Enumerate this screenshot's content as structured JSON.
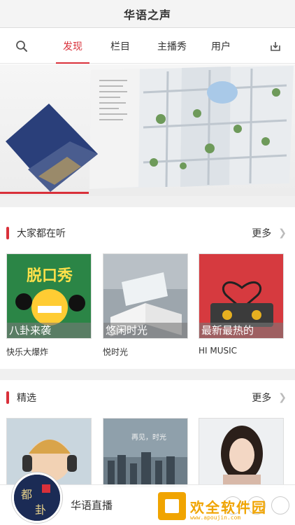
{
  "app": {
    "title": "华语之声"
  },
  "nav": {
    "tabs": [
      {
        "label": "发现"
      },
      {
        "label": "栏目"
      },
      {
        "label": "主播秀"
      },
      {
        "label": "用户"
      }
    ],
    "active_tab": "发现",
    "search_icon": "search-icon",
    "download_icon": "download-icon"
  },
  "banner": {
    "progress": 0.3
  },
  "sections": {
    "popular": {
      "title": "大家都在听",
      "more": "更多",
      "items": [
        {
          "overlay": "八卦来袭",
          "name": "快乐大爆炸",
          "badge": "脱口秀"
        },
        {
          "overlay": "悠闲时光",
          "name": "悦时光"
        },
        {
          "overlay": "最新最热的",
          "name": "HI MUSIC"
        }
      ]
    },
    "featured": {
      "title": "精选",
      "more": "更多",
      "items": [
        {
          "caption": ""
        },
        {
          "caption": "再见，时光"
        },
        {
          "caption": ""
        }
      ]
    }
  },
  "player": {
    "label": "华语直播"
  },
  "watermark": {
    "text": "欢全软件园",
    "url": "www.apoujin.com"
  },
  "colors": {
    "accent": "#d9303a",
    "watermark": "#f0a400"
  }
}
